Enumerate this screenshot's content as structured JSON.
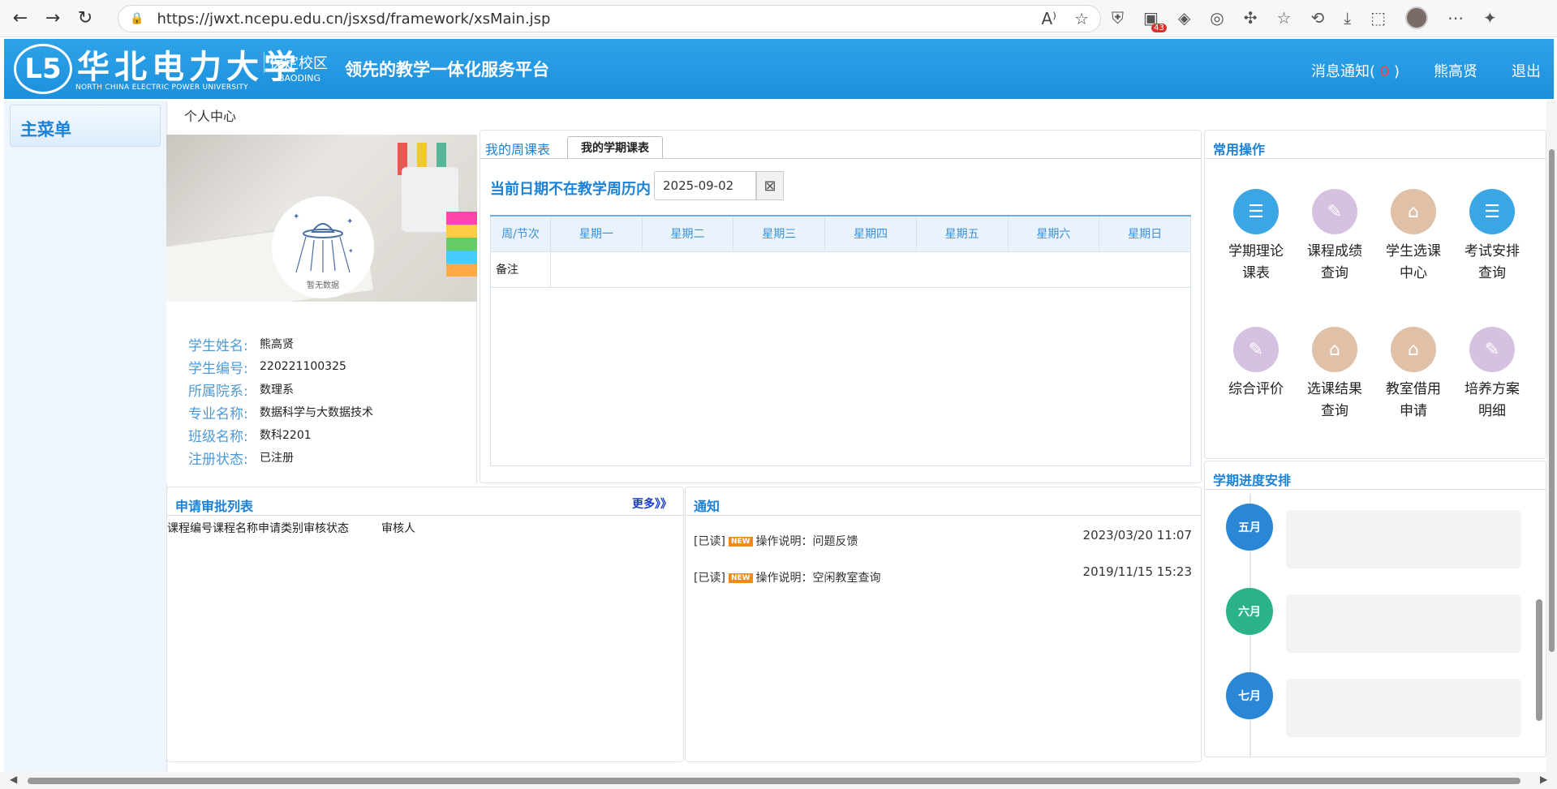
{
  "browser": {
    "url": "https://jwxt.ncepu.edu.cn/jsxsd/framework/xsMain.jsp",
    "badge_count": "43"
  },
  "header": {
    "univ_name": "华北电力大学",
    "univ_en": "NORTH CHINA ELECTRIC POWER UNIVERSITY",
    "campus": "保定校区",
    "campus_en": "BAODING",
    "slogan": "领先的教学一体化服务平台",
    "messages_label": "消息通知(",
    "messages_count": "0",
    "messages_close": ")",
    "user_name": "熊高贤",
    "logout": "退出"
  },
  "menu": {
    "title": "主菜单"
  },
  "breadcrumb": "个人中心",
  "profile": {
    "nodata": "暂无数据",
    "rows": [
      {
        "key": "学生姓名:",
        "value": "熊高贤"
      },
      {
        "key": "学生编号:",
        "value": "220221100325"
      },
      {
        "key": "所属院系:",
        "value": "数理系"
      },
      {
        "key": "专业名称:",
        "value": "数据科学与大数据技术"
      },
      {
        "key": "班级名称:",
        "value": "数科2201"
      },
      {
        "key": "注册状态:",
        "value": "已注册"
      }
    ]
  },
  "schedule": {
    "tab_week": "我的周课表",
    "tab_term": "我的学期课表",
    "date_msg": "当前日期不在教学周历内",
    "date_value": "2025-09-02",
    "columns": [
      "周/节次",
      "星期一",
      "星期二",
      "星期三",
      "星期四",
      "星期五",
      "星期六",
      "星期日"
    ],
    "remark": "备注"
  },
  "ops": {
    "title": "常用操作",
    "items": [
      {
        "label1": "学期理论",
        "label2": "课表",
        "color": "#3aa6e4"
      },
      {
        "label1": "课程成绩",
        "label2": "查询",
        "color": "#d7c1e0"
      },
      {
        "label1": "学生选课",
        "label2": "中心",
        "color": "#e0c0a6"
      },
      {
        "label1": "考试安排",
        "label2": "查询",
        "color": "#3aa6e4"
      },
      {
        "label1": "综合评价",
        "label2": "",
        "color": "#d7c1e0"
      },
      {
        "label1": "选课结果",
        "label2": "查询",
        "color": "#e0c0a6"
      },
      {
        "label1": "教室借用",
        "label2": "申请",
        "color": "#e0c0a6"
      },
      {
        "label1": "培养方案",
        "label2": "明细",
        "color": "#d7c1e0"
      }
    ]
  },
  "progress": {
    "title": "学期进度安排",
    "months": [
      "五月",
      "六月",
      "七月"
    ]
  },
  "approval": {
    "title": "申请审批列表",
    "more": "更多》》",
    "headers": [
      "课程编号",
      "课程名称",
      "申请类别",
      "审核状态",
      "审核人"
    ]
  },
  "notice": {
    "title": "通知",
    "items": [
      {
        "status": "[已读]",
        "tag": "NEW",
        "text": "操作说明：问题反馈",
        "time": "2023/03/20 11:07"
      },
      {
        "status": "[已读]",
        "tag": "NEW",
        "text": "操作说明：空闲教室查询",
        "time": "2019/11/15 15:23"
      }
    ]
  }
}
